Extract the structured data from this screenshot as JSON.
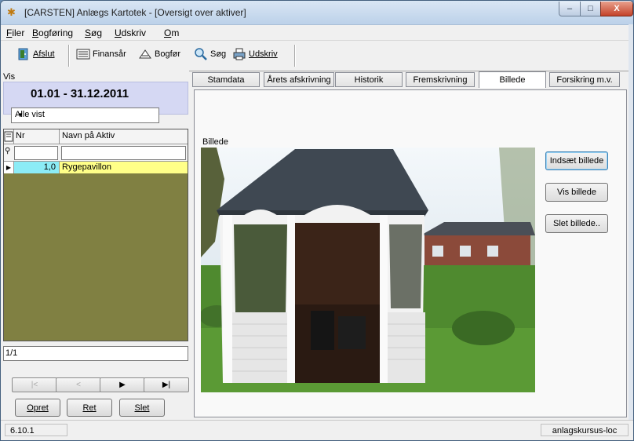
{
  "window": {
    "title": "[CARSTEN] Anlægs Kartotek - [Oversigt over aktiver]",
    "controls": {
      "minimize": "–",
      "maximize": "□",
      "close": "X"
    }
  },
  "menu": {
    "items": [
      {
        "label": "Filer",
        "key": "F"
      },
      {
        "label": "Bogføring",
        "key": "B"
      },
      {
        "label": "Søg",
        "key": "S"
      },
      {
        "label": "Udskriv",
        "key": "U"
      },
      {
        "label": "Om",
        "key": "O"
      }
    ]
  },
  "toolbar": {
    "afslut": "Afslut",
    "finansaar": "Finansår",
    "bogfor": "Bogfør",
    "sog": "Søg",
    "udskriv": "Udskriv"
  },
  "left": {
    "vis_label": "Vis",
    "date_range": "01.01 - 31.12.2011",
    "filter_value": "Alle vist",
    "grid": {
      "columns": [
        "Nr",
        "Navn på Aktiv"
      ],
      "rows": [
        {
          "nr": "1,0",
          "name": "Rygepavillon"
        }
      ]
    },
    "pager": "1/1",
    "nav": {
      "first": "|<",
      "prev": "<",
      "next": "▶",
      "last": "▶|"
    },
    "actions": {
      "opret": "Opret",
      "ret": "Ret",
      "slet": "Slet"
    }
  },
  "tabs": [
    {
      "label": "Stamdata"
    },
    {
      "label": "Årets afskrivning"
    },
    {
      "label": "Historik"
    },
    {
      "label": "Fremskrivning"
    },
    {
      "label": "Billede",
      "active": true
    },
    {
      "label": "Forsikring m.v."
    }
  ],
  "panel": {
    "billede_label": "Billede",
    "buttons": {
      "indsaet": "Indsæt billede",
      "vis": "Vis billede",
      "slet": "Slet billede.."
    }
  },
  "status": {
    "version": "6.10.1",
    "host": "anlagskursus-loc"
  },
  "colors": {
    "grid_bg": "#808042",
    "selected_row": "#ffff88",
    "nr_cell": "#8cecf6",
    "date_panel": "#d5d8f3"
  }
}
